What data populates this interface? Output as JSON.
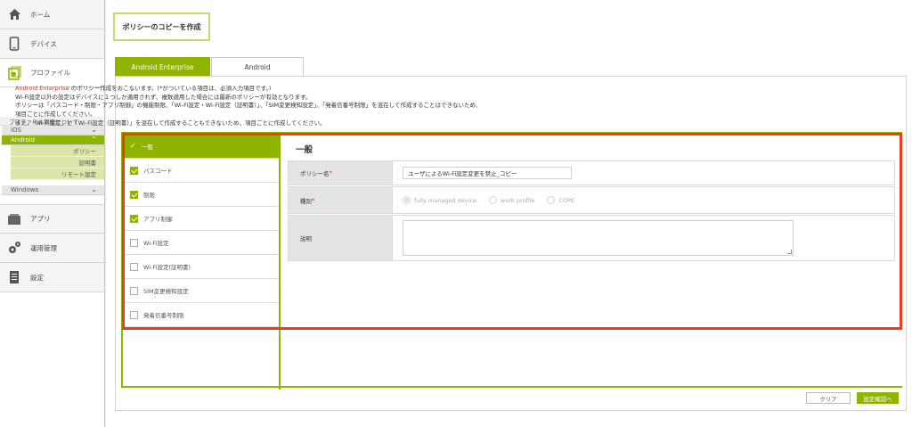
{
  "sidebar": {
    "home": "ホーム",
    "device": "デバイス",
    "profile": "プロファイル",
    "profile_manage": "プロファイル管理について",
    "ios": "iOS",
    "android": "Android",
    "android_items": [
      "ポリシー",
      "証明書",
      "リモート設定"
    ],
    "windows": "Windows",
    "app": "アプリ",
    "ops": "運用管理",
    "settings": "設定"
  },
  "page": {
    "title": "ポリシーのコピーを作成",
    "tabs": [
      "Android Enterprise",
      "Android"
    ],
    "intro": {
      "brand": "Android Enterprise",
      "line1_rest": " のポリシー作成をおこないます。(*がついている項目は、必須入力項目です。)",
      "line2": "Wi-Fi設定以外の設定はデバイスに１つしか適用されず、複数適用した場合には最新のポリシーが有効となります。",
      "line3": "ポリシーは「パスコード・制限・アプリ制御」の機能制限、「Wi-Fi設定・Wi-Fi設定（証明書）」、「SIM変更検知設定」、「発着信番号制限」を混在して作成することはできないため、",
      "line4": "項目ごとに作成してください。",
      "line5": "また、「Wi-Fi設定」と「Wi-Fi設定（証明書）」を混在して作成することもできないため、項目ごとに作成してください。"
    }
  },
  "steps": [
    {
      "label": "一般",
      "state": "current"
    },
    {
      "label": "パスコード",
      "state": "checked"
    },
    {
      "label": "制限",
      "state": "checked"
    },
    {
      "label": "アプリ制御",
      "state": "checked"
    },
    {
      "label": "Wi-Fi設定",
      "state": "unchecked"
    },
    {
      "label": "Wi-Fi設定(証明書)",
      "state": "unchecked"
    },
    {
      "label": "SIM変更検知設定",
      "state": "unchecked"
    },
    {
      "label": "発着信番号制限",
      "state": "unchecked"
    }
  ],
  "form": {
    "section": "一般",
    "policy_name_label": "ポリシー名",
    "required_mark": "*",
    "policy_name_value": "ユーザによるWi-Fi設定変更を禁止_コピー",
    "type_label": "種別",
    "type_options": [
      "fully managed device",
      "work profile",
      "COPE"
    ],
    "type_selected": "fully managed device",
    "desc_label": "説明",
    "desc_value": ""
  },
  "buttons": {
    "clear": "クリア",
    "confirm": "設定確認へ"
  },
  "colors": {
    "accent": "#8fb400",
    "highlight": "#ee3b1f",
    "required": "#c0392b"
  }
}
